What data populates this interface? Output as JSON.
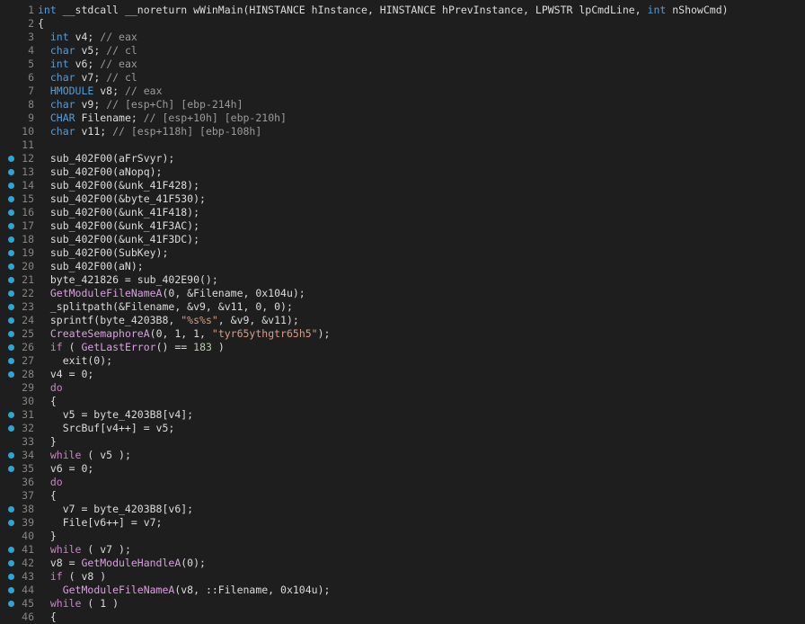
{
  "editor": {
    "language": "pseudocode",
    "colors": {
      "background": "#1e1e1e",
      "breakpoint_dot": "#2aa7d9",
      "line_number": "#858585"
    },
    "lines": [
      {
        "n": "1",
        "bp": false,
        "tokens": [
          [
            "ty",
            "int"
          ],
          [
            "pl",
            " __stdcall __noreturn wWinMain(HINSTANCE hInstance, HINSTANCE hPrevInstance, LPWSTR lpCmdLine, "
          ],
          [
            "ty",
            "int"
          ],
          [
            "pl",
            " nShowCmd)"
          ]
        ]
      },
      {
        "n": "2",
        "bp": false,
        "tokens": [
          [
            "pl",
            "{"
          ]
        ]
      },
      {
        "n": "3",
        "bp": false,
        "tokens": [
          [
            "pl",
            "  "
          ],
          [
            "ty",
            "int"
          ],
          [
            "pl",
            " v4; "
          ],
          [
            "cmt",
            "// eax"
          ]
        ]
      },
      {
        "n": "4",
        "bp": false,
        "tokens": [
          [
            "pl",
            "  "
          ],
          [
            "ty",
            "char"
          ],
          [
            "pl",
            " v5; "
          ],
          [
            "cmt",
            "// cl"
          ]
        ]
      },
      {
        "n": "5",
        "bp": false,
        "tokens": [
          [
            "pl",
            "  "
          ],
          [
            "ty",
            "int"
          ],
          [
            "pl",
            " v6; "
          ],
          [
            "cmt",
            "// eax"
          ]
        ]
      },
      {
        "n": "6",
        "bp": false,
        "tokens": [
          [
            "pl",
            "  "
          ],
          [
            "ty",
            "char"
          ],
          [
            "pl",
            " v7; "
          ],
          [
            "cmt",
            "// cl"
          ]
        ]
      },
      {
        "n": "7",
        "bp": false,
        "tokens": [
          [
            "pl",
            "  "
          ],
          [
            "ty",
            "HMODULE"
          ],
          [
            "pl",
            " v8; "
          ],
          [
            "cmt",
            "// eax"
          ]
        ]
      },
      {
        "n": "8",
        "bp": false,
        "tokens": [
          [
            "pl",
            "  "
          ],
          [
            "ty",
            "char"
          ],
          [
            "pl",
            " v9; "
          ],
          [
            "cmt",
            "// [esp+Ch] [ebp-214h]"
          ]
        ]
      },
      {
        "n": "9",
        "bp": false,
        "tokens": [
          [
            "pl",
            "  "
          ],
          [
            "ty",
            "CHAR"
          ],
          [
            "pl",
            " Filename; "
          ],
          [
            "cmt",
            "// [esp+10h] [ebp-210h]"
          ]
        ]
      },
      {
        "n": "10",
        "bp": false,
        "tokens": [
          [
            "pl",
            "  "
          ],
          [
            "ty",
            "char"
          ],
          [
            "pl",
            " v11; "
          ],
          [
            "cmt",
            "// [esp+118h] [ebp-108h]"
          ]
        ]
      },
      {
        "n": "11",
        "bp": false,
        "tokens": []
      },
      {
        "n": "12",
        "bp": true,
        "tokens": [
          [
            "pl",
            "  sub_402F00(aFrSvyr);"
          ]
        ]
      },
      {
        "n": "13",
        "bp": true,
        "tokens": [
          [
            "pl",
            "  sub_402F00(aNopq);"
          ]
        ]
      },
      {
        "n": "14",
        "bp": true,
        "tokens": [
          [
            "pl",
            "  sub_402F00(&unk_41F428);"
          ]
        ]
      },
      {
        "n": "15",
        "bp": true,
        "tokens": [
          [
            "pl",
            "  sub_402F00(&byte_41F530);"
          ]
        ]
      },
      {
        "n": "16",
        "bp": true,
        "tokens": [
          [
            "pl",
            "  sub_402F00(&unk_41F418);"
          ]
        ]
      },
      {
        "n": "17",
        "bp": true,
        "tokens": [
          [
            "pl",
            "  sub_402F00(&unk_41F3AC);"
          ]
        ]
      },
      {
        "n": "18",
        "bp": true,
        "tokens": [
          [
            "pl",
            "  sub_402F00(&unk_41F3DC);"
          ]
        ]
      },
      {
        "n": "19",
        "bp": true,
        "tokens": [
          [
            "pl",
            "  sub_402F00(SubKey);"
          ]
        ]
      },
      {
        "n": "20",
        "bp": true,
        "tokens": [
          [
            "pl",
            "  sub_402F00(aN);"
          ]
        ]
      },
      {
        "n": "21",
        "bp": true,
        "tokens": [
          [
            "pl",
            "  byte_421826 = sub_402E90();"
          ]
        ]
      },
      {
        "n": "22",
        "bp": true,
        "tokens": [
          [
            "pl",
            "  "
          ],
          [
            "fn",
            "GetModuleFileNameA"
          ],
          [
            "pl",
            "(0, &Filename, 0x104u);"
          ]
        ]
      },
      {
        "n": "23",
        "bp": true,
        "tokens": [
          [
            "pl",
            "  _splitpath(&Filename, &v9, &v11, 0, 0);"
          ]
        ]
      },
      {
        "n": "24",
        "bp": true,
        "tokens": [
          [
            "pl",
            "  sprintf(byte_4203B8, "
          ],
          [
            "str",
            "\"%s%s\""
          ],
          [
            "pl",
            ", &v9, &v11);"
          ]
        ]
      },
      {
        "n": "25",
        "bp": true,
        "tokens": [
          [
            "pl",
            "  "
          ],
          [
            "fn",
            "CreateSemaphoreA"
          ],
          [
            "pl",
            "(0, 1, 1, "
          ],
          [
            "str",
            "\"tyr65ythgtr65h5\""
          ],
          [
            "pl",
            ");"
          ]
        ]
      },
      {
        "n": "26",
        "bp": true,
        "tokens": [
          [
            "pl",
            "  "
          ],
          [
            "kw",
            "if"
          ],
          [
            "pl",
            " ( "
          ],
          [
            "fn",
            "GetLastError"
          ],
          [
            "pl",
            "() == "
          ],
          [
            "num",
            "183"
          ],
          [
            "pl",
            " )"
          ]
        ]
      },
      {
        "n": "27",
        "bp": true,
        "tokens": [
          [
            "pl",
            "    exit(0);"
          ]
        ]
      },
      {
        "n": "28",
        "bp": true,
        "tokens": [
          [
            "pl",
            "  v4 = 0;"
          ]
        ]
      },
      {
        "n": "29",
        "bp": false,
        "tokens": [
          [
            "pl",
            "  "
          ],
          [
            "kw",
            "do"
          ]
        ]
      },
      {
        "n": "30",
        "bp": false,
        "tokens": [
          [
            "pl",
            "  {"
          ]
        ]
      },
      {
        "n": "31",
        "bp": true,
        "tokens": [
          [
            "pl",
            "    v5 = byte_4203B8[v4];"
          ]
        ]
      },
      {
        "n": "32",
        "bp": true,
        "tokens": [
          [
            "pl",
            "    SrcBuf[v4++] = v5;"
          ]
        ]
      },
      {
        "n": "33",
        "bp": false,
        "tokens": [
          [
            "pl",
            "  }"
          ]
        ]
      },
      {
        "n": "34",
        "bp": true,
        "tokens": [
          [
            "pl",
            "  "
          ],
          [
            "kw",
            "while"
          ],
          [
            "pl",
            " ( v5 );"
          ]
        ]
      },
      {
        "n": "35",
        "bp": true,
        "tokens": [
          [
            "pl",
            "  v6 = 0;"
          ]
        ]
      },
      {
        "n": "36",
        "bp": false,
        "tokens": [
          [
            "pl",
            "  "
          ],
          [
            "kw",
            "do"
          ]
        ]
      },
      {
        "n": "37",
        "bp": false,
        "tokens": [
          [
            "pl",
            "  {"
          ]
        ]
      },
      {
        "n": "38",
        "bp": true,
        "tokens": [
          [
            "pl",
            "    v7 = byte_4203B8[v6];"
          ]
        ]
      },
      {
        "n": "39",
        "bp": true,
        "tokens": [
          [
            "pl",
            "    File[v6++] = v7;"
          ]
        ]
      },
      {
        "n": "40",
        "bp": false,
        "tokens": [
          [
            "pl",
            "  }"
          ]
        ]
      },
      {
        "n": "41",
        "bp": true,
        "tokens": [
          [
            "pl",
            "  "
          ],
          [
            "kw",
            "while"
          ],
          [
            "pl",
            " ( v7 );"
          ]
        ]
      },
      {
        "n": "42",
        "bp": true,
        "tokens": [
          [
            "pl",
            "  v8 = "
          ],
          [
            "fn",
            "GetModuleHandleA"
          ],
          [
            "pl",
            "(0);"
          ]
        ]
      },
      {
        "n": "43",
        "bp": true,
        "tokens": [
          [
            "pl",
            "  "
          ],
          [
            "kw",
            "if"
          ],
          [
            "pl",
            " ( v8 )"
          ]
        ]
      },
      {
        "n": "44",
        "bp": true,
        "tokens": [
          [
            "pl",
            "    "
          ],
          [
            "fn",
            "GetModuleFileNameA"
          ],
          [
            "pl",
            "(v8, ::Filename, 0x104u);"
          ]
        ]
      },
      {
        "n": "45",
        "bp": true,
        "tokens": [
          [
            "pl",
            "  "
          ],
          [
            "kw",
            "while"
          ],
          [
            "pl",
            " ( 1 )"
          ]
        ]
      },
      {
        "n": "46",
        "bp": false,
        "tokens": [
          [
            "pl",
            "  {"
          ]
        ]
      }
    ]
  }
}
